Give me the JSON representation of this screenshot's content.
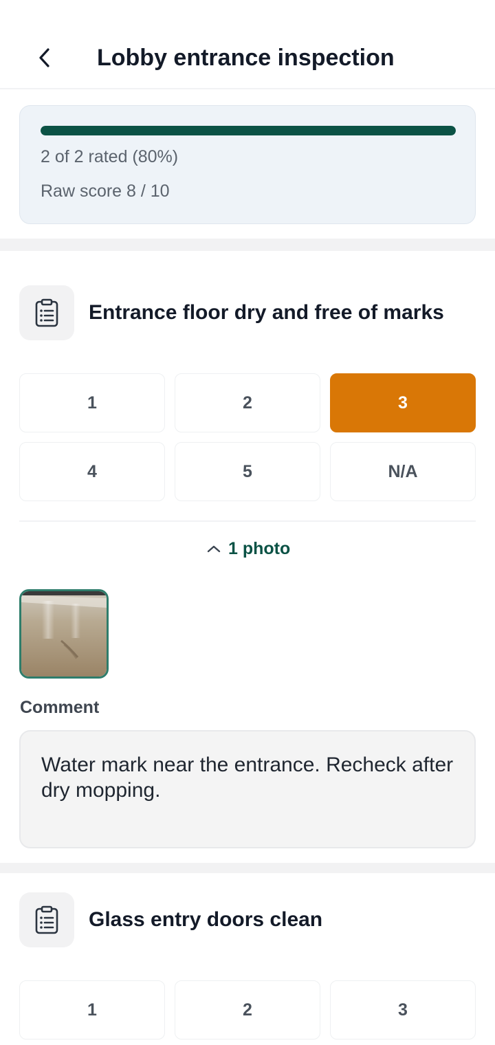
{
  "header": {
    "title": "Lobby entrance inspection"
  },
  "progress": {
    "fraction": 1.0,
    "rated_text": "2 of 2 rated (80%)",
    "raw_score_text": "Raw score 8 / 10",
    "fill_color": "#0b5245"
  },
  "items": [
    {
      "title": "Entrance floor dry and free of marks",
      "icon": "clipboard-list-icon",
      "ratings": [
        "1",
        "2",
        "3",
        "4",
        "5",
        "N/A"
      ],
      "selected": "3",
      "photo_toggle_label": "1 photo",
      "comment_label": "Comment",
      "comment_value": "Water mark near the entrance. Recheck after dry mopping."
    },
    {
      "title": "Glass entry doors clean",
      "icon": "clipboard-list-icon",
      "ratings": [
        "1",
        "2",
        "3"
      ]
    }
  ],
  "colors": {
    "accent": "#0b5245",
    "selected_rating": "#d97706"
  }
}
